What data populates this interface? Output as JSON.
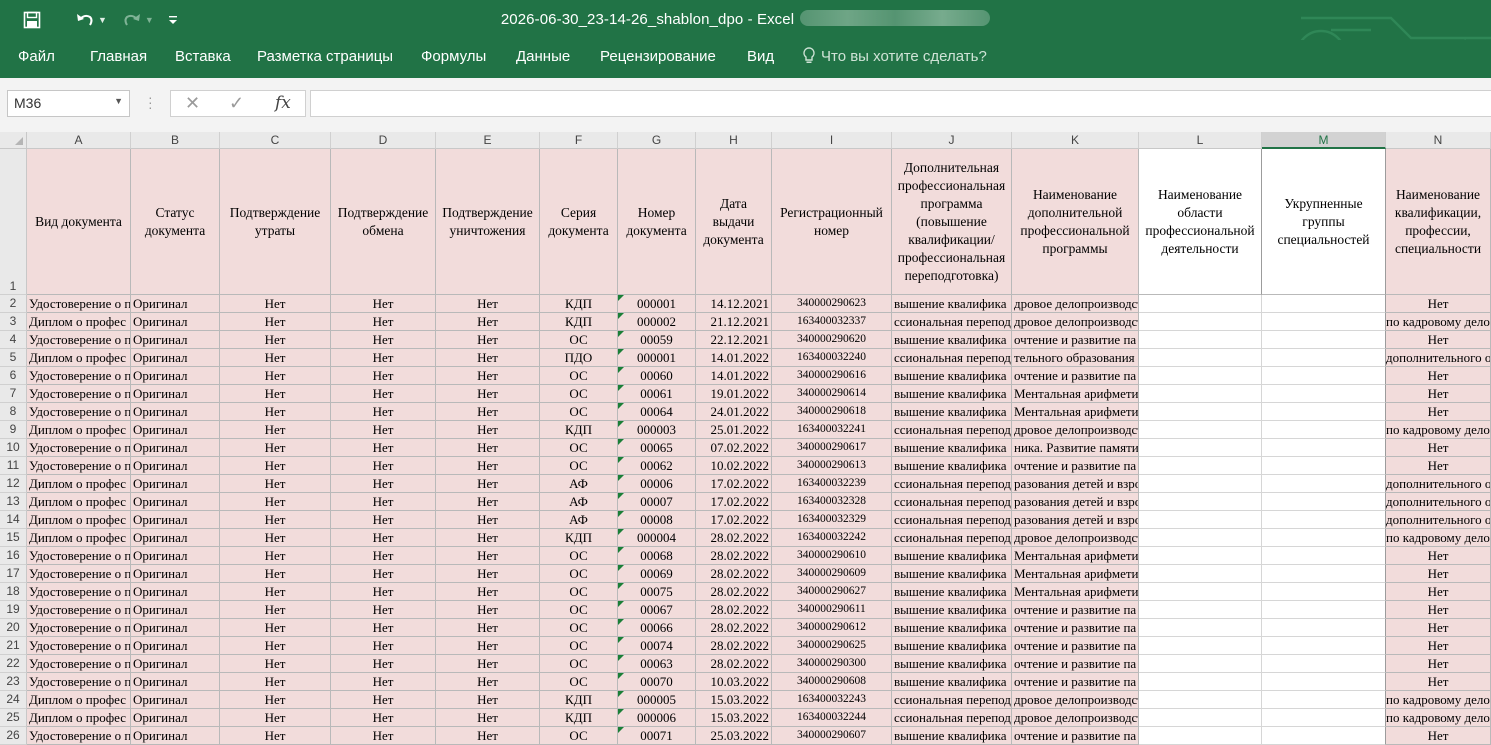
{
  "window": {
    "title": "2026-06-30_23-14-26_shablon_dpo - Excel"
  },
  "ribbon": {
    "tabs": [
      "Файл",
      "Главная",
      "Вставка",
      "Разметка страницы",
      "Формулы",
      "Данные",
      "Рецензирование",
      "Вид"
    ],
    "tell_me": "Что вы хотите сделать?"
  },
  "formula_bar": {
    "name_box": "M36",
    "fx_label": "fx",
    "content": ""
  },
  "sheet": {
    "selected_column": "M",
    "columns": [
      "A",
      "B",
      "C",
      "D",
      "E",
      "F",
      "G",
      "H",
      "I",
      "J",
      "K",
      "L",
      "M",
      "N"
    ],
    "headers": [
      "Вид документа",
      "Статус документа",
      "Подтверждение утраты",
      "Подтверждение обмена",
      "Подтверждение уничтожения",
      "Серия документа",
      "Номер документа",
      "Дата выдачи документа",
      "Регистрационный номер",
      "Дополнительная профессиональная программа (повышение квалификации/ профессиональная переподготовка)",
      "Наименование дополнительной профессиональной программы",
      "Наименование области профессиональной деятельности",
      "Укрупненные группы специальностей",
      "Наименование квалификации, профессии, специальности"
    ],
    "row_numbers": [
      "1",
      "2",
      "3",
      "4",
      "5",
      "6",
      "7",
      "8",
      "9",
      "10",
      "11",
      "12",
      "13",
      "14",
      "15",
      "16",
      "17",
      "18",
      "19",
      "20",
      "21",
      "22",
      "23",
      "24",
      "25",
      "26"
    ],
    "rows": [
      [
        "Удостоверение о п",
        "Оригинал",
        "Нет",
        "Нет",
        "Нет",
        "КДП",
        "000001",
        "14.12.2021",
        "340000290623",
        "вышение квалифика",
        "дровое делопроизводст",
        "",
        "",
        "Нет"
      ],
      [
        "Диплом о профес",
        "Оригинал",
        "Нет",
        "Нет",
        "Нет",
        "КДП",
        "000002",
        "21.12.2021",
        "163400032337",
        "ссиональная переподг",
        "дровое делопроизводст",
        "",
        "",
        "по кадровому делоп"
      ],
      [
        "Удостоверение о п",
        "Оригинал",
        "Нет",
        "Нет",
        "Нет",
        "ОС",
        "00059",
        "22.12.2021",
        "340000290620",
        "вышение квалифика",
        "очтение и развитие па",
        "",
        "",
        "Нет"
      ],
      [
        "Диплом о профес",
        "Оригинал",
        "Нет",
        "Нет",
        "Нет",
        "ПДО",
        "000001",
        "14.01.2022",
        "163400032240",
        "ссиональная переподг",
        "тельного образования",
        "",
        "",
        "дополнительного обр"
      ],
      [
        "Удостоверение о п",
        "Оригинал",
        "Нет",
        "Нет",
        "Нет",
        "ОС",
        "00060",
        "14.01.2022",
        "340000290616",
        "вышение квалифика",
        "очтение и развитие па",
        "",
        "",
        "Нет"
      ],
      [
        "Удостоверение о п",
        "Оригинал",
        "Нет",
        "Нет",
        "Нет",
        "ОС",
        "00061",
        "19.01.2022",
        "340000290614",
        "вышение квалифика",
        "Ментальная арифметик",
        "",
        "",
        "Нет"
      ],
      [
        "Удостоверение о п",
        "Оригинал",
        "Нет",
        "Нет",
        "Нет",
        "ОС",
        "00064",
        "24.01.2022",
        "340000290618",
        "вышение квалифика",
        "Ментальная арифметик",
        "",
        "",
        "Нет"
      ],
      [
        "Диплом о профес",
        "Оригинал",
        "Нет",
        "Нет",
        "Нет",
        "КДП",
        "000003",
        "25.01.2022",
        "163400032241",
        "ссиональная переподг",
        "дровое делопроизводст",
        "",
        "",
        "по кадровому делоп"
      ],
      [
        "Удостоверение о п",
        "Оригинал",
        "Нет",
        "Нет",
        "Нет",
        "ОС",
        "00065",
        "07.02.2022",
        "340000290617",
        "вышение квалифика",
        "ника. Развитие памяти и",
        "",
        "",
        "Нет"
      ],
      [
        "Удостоверение о п",
        "Оригинал",
        "Нет",
        "Нет",
        "Нет",
        "ОС",
        "00062",
        "10.02.2022",
        "340000290613",
        "вышение квалифика",
        "очтение и развитие па",
        "",
        "",
        "Нет"
      ],
      [
        "Диплом о профес",
        "Оригинал",
        "Нет",
        "Нет",
        "Нет",
        "АФ",
        "00006",
        "17.02.2022",
        "163400032239",
        "ссиональная переподг",
        "разования детей и взрос",
        "",
        "",
        "дополнительного обр"
      ],
      [
        "Диплом о профес",
        "Оригинал",
        "Нет",
        "Нет",
        "Нет",
        "АФ",
        "00007",
        "17.02.2022",
        "163400032328",
        "ссиональная переподг",
        "разования детей и взрос",
        "",
        "",
        "дополнительного обр"
      ],
      [
        "Диплом о профес",
        "Оригинал",
        "Нет",
        "Нет",
        "Нет",
        "АФ",
        "00008",
        "17.02.2022",
        "163400032329",
        "ссиональная переподг",
        "разования детей и взрос",
        "",
        "",
        "дополнительного обр"
      ],
      [
        "Диплом о профес",
        "Оригинал",
        "Нет",
        "Нет",
        "Нет",
        "КДП",
        "000004",
        "28.02.2022",
        "163400032242",
        "ссиональная переподг",
        "дровое делопроизводст",
        "",
        "",
        "по кадровому делоп"
      ],
      [
        "Удостоверение о п",
        "Оригинал",
        "Нет",
        "Нет",
        "Нет",
        "ОС",
        "00068",
        "28.02.2022",
        "340000290610",
        "вышение квалифика",
        "Ментальная арифметик",
        "",
        "",
        "Нет"
      ],
      [
        "Удостоверение о п",
        "Оригинал",
        "Нет",
        "Нет",
        "Нет",
        "ОС",
        "00069",
        "28.02.2022",
        "340000290609",
        "вышение квалифика",
        "Ментальная арифметик",
        "",
        "",
        "Нет"
      ],
      [
        "Удостоверение о п",
        "Оригинал",
        "Нет",
        "Нет",
        "Нет",
        "ОС",
        "00075",
        "28.02.2022",
        "340000290627",
        "вышение квалифика",
        "Ментальная арифметик",
        "",
        "",
        "Нет"
      ],
      [
        "Удостоверение о п",
        "Оригинал",
        "Нет",
        "Нет",
        "Нет",
        "ОС",
        "00067",
        "28.02.2022",
        "340000290611",
        "вышение квалифика",
        "очтение и развитие па",
        "",
        "",
        "Нет"
      ],
      [
        "Удостоверение о п",
        "Оригинал",
        "Нет",
        "Нет",
        "Нет",
        "ОС",
        "00066",
        "28.02.2022",
        "340000290612",
        "вышение квалифика",
        "очтение и развитие па",
        "",
        "",
        "Нет"
      ],
      [
        "Удостоверение о п",
        "Оригинал",
        "Нет",
        "Нет",
        "Нет",
        "ОС",
        "00074",
        "28.02.2022",
        "340000290625",
        "вышение квалифика",
        "очтение и развитие па",
        "",
        "",
        "Нет"
      ],
      [
        "Удостоверение о п",
        "Оригинал",
        "Нет",
        "Нет",
        "Нет",
        "ОС",
        "00063",
        "28.02.2022",
        "340000290300",
        "вышение квалифика",
        "очтение и развитие па",
        "",
        "",
        "Нет"
      ],
      [
        "Удостоверение о п",
        "Оригинал",
        "Нет",
        "Нет",
        "Нет",
        "ОС",
        "00070",
        "10.03.2022",
        "340000290608",
        "вышение квалифика",
        "очтение и развитие па",
        "",
        "",
        "Нет"
      ],
      [
        "Диплом о профес",
        "Оригинал",
        "Нет",
        "Нет",
        "Нет",
        "КДП",
        "000005",
        "15.03.2022",
        "163400032243",
        "ссиональная переподг",
        "дровое делопроизводст",
        "",
        "",
        "по кадровому делоп"
      ],
      [
        "Диплом о профес",
        "Оригинал",
        "Нет",
        "Нет",
        "Нет",
        "КДП",
        "000006",
        "15.03.2022",
        "163400032244",
        "ссиональная переподг",
        "дровое делопроизводст",
        "",
        "",
        "по кадровому делоп"
      ],
      [
        "Удостоверение о п",
        "Оригинал",
        "Нет",
        "Нет",
        "Нет",
        "ОС",
        "00071",
        "25.03.2022",
        "340000290607",
        "вышение квалифика",
        "очтение и развитие па",
        "",
        "",
        "Нет"
      ]
    ]
  },
  "colors": {
    "ribbon": "#217346",
    "cell_fill": "#f2dcdb",
    "grid_line": "#b9b9b9"
  }
}
